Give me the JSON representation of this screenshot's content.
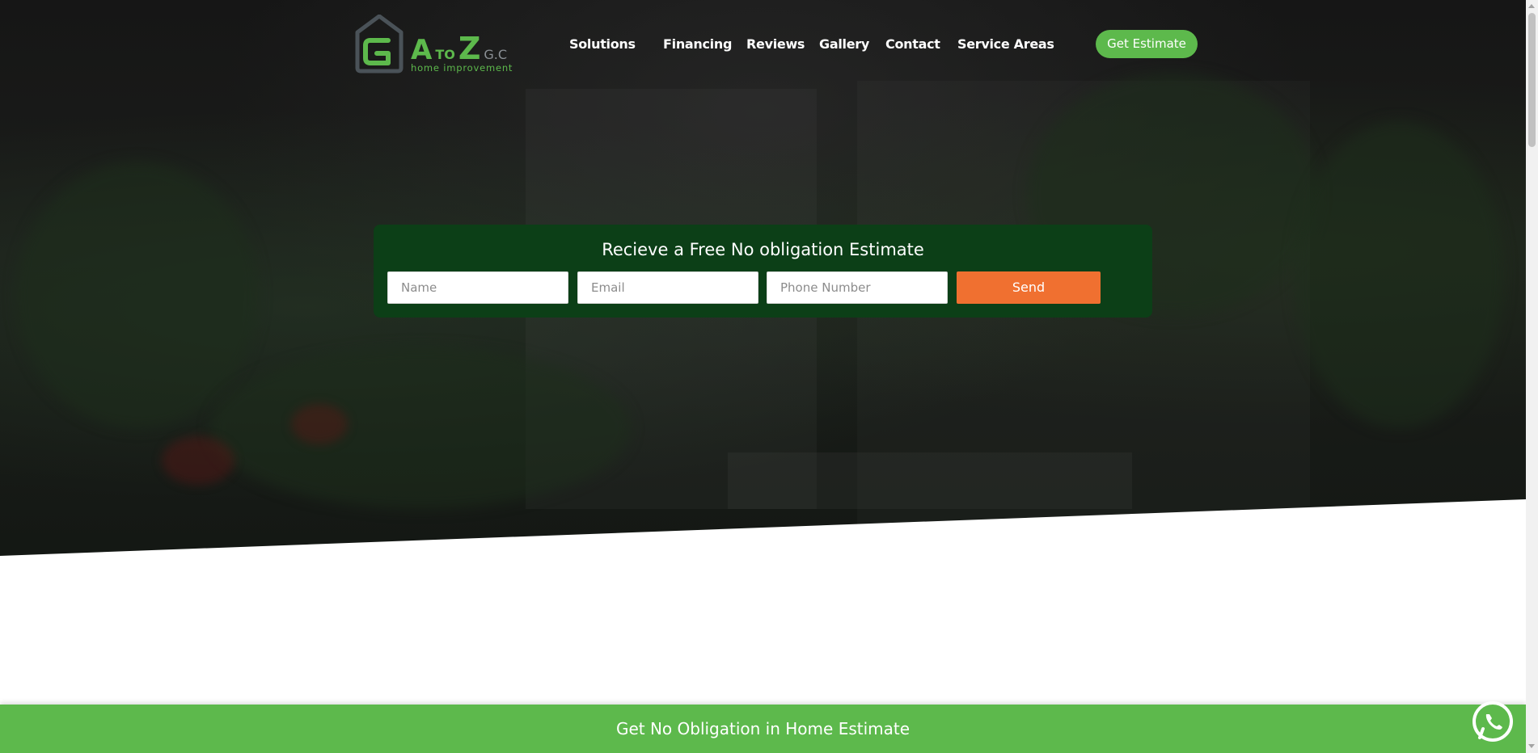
{
  "header": {
    "logo_text_a": "A",
    "logo_text_to": "TO",
    "logo_text_z": "Z",
    "logo_text_gc": "G.C",
    "logo_tagline": "home improvement",
    "nav": [
      {
        "label": "Solutions"
      },
      {
        "label": "Financing"
      },
      {
        "label": "Reviews"
      },
      {
        "label": "Gallery"
      },
      {
        "label": "Contact"
      },
      {
        "label": "Service Areas"
      }
    ],
    "cta_label": "Get Estimate"
  },
  "estimate_form": {
    "title": "Recieve a Free No obligation Estimate",
    "name_placeholder": "Name",
    "email_placeholder": "Email",
    "phone_placeholder": "Phone Number",
    "name_value": "",
    "email_value": "",
    "phone_value": "",
    "send_label": "Send"
  },
  "bottom_bar": {
    "label": "Get No Obligation in Home Estimate"
  },
  "icons": {
    "whatsapp": "whatsapp-icon",
    "logo": "house-logo-icon"
  },
  "colors": {
    "brand_green": "#5db94c",
    "form_bg": "#0c3f17",
    "send_orange": "#f07030"
  }
}
